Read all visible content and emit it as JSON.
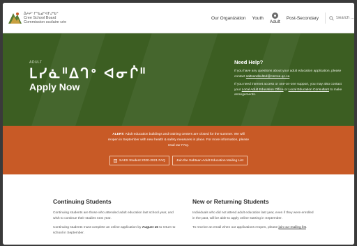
{
  "header": {
    "logo_syllabics": "ᐄᔨᔨᐤ ᒋᔅᑲᓅᐦᐊᒥᒍᐦᑲᓐ",
    "logo_line2": "Cree School Board",
    "logo_line3": "Commission scolaire crie",
    "nav": {
      "our_organization": "Our Organization",
      "youth": "Youth",
      "adult": "Adult",
      "post_secondary": "Post-Secondary"
    },
    "search_placeholder": "Search ..."
  },
  "hero": {
    "label": "ADULT",
    "syllabics": "ᒪᓯᓈᐦᐃᒉᐤ ᐊᓂᒌᐦ",
    "title": "Apply Now",
    "help": {
      "heading": "Need Help?",
      "p1_text": "If you have any questions about your adult education application, please contact ",
      "p1_link": "saltsandsulted@csrcee.qc.ca",
      "p2_text": "If you need internet access or one-on-one support, you may also contact your ",
      "p2_link1": "Local Adult Education Office",
      "p2_mid": " or ",
      "p2_link2": "Local Education Consultant",
      "p2_end": " to make arrangements."
    }
  },
  "alert": {
    "bold": "ALERT:",
    "line1": " Adult education buildings and training centers are closed for the summer. We will",
    "line2": "reopen in September with new health & safety measures in place. For more information, please",
    "line3": "read our FAQ.",
    "button1": "SAES Student 2020-2021 FAQ",
    "button2": "Join the Sabtaan Adult Education Mailing List"
  },
  "continuing": {
    "heading": "Continuing Students",
    "p1": "Continuing students are those who attended adult education last school year, and wish to continue their studies next year.",
    "p2_pre": "Continuing students must complete an online application by ",
    "p2_bold": "August 15",
    "p2_post": " to return to school in September."
  },
  "new_returning": {
    "heading": "New or Returning Students",
    "p1": "Individuals who did not attend adult education last year, even if they were enrolled in the past, will be able to apply online starting in September.",
    "p2_pre": "To receive an email when our applications reopen, please ",
    "p2_link": "join our mailing list",
    "p2_post": "."
  },
  "colors": {
    "hero_green": "#3c5e22",
    "alert_orange": "#c85a26"
  }
}
